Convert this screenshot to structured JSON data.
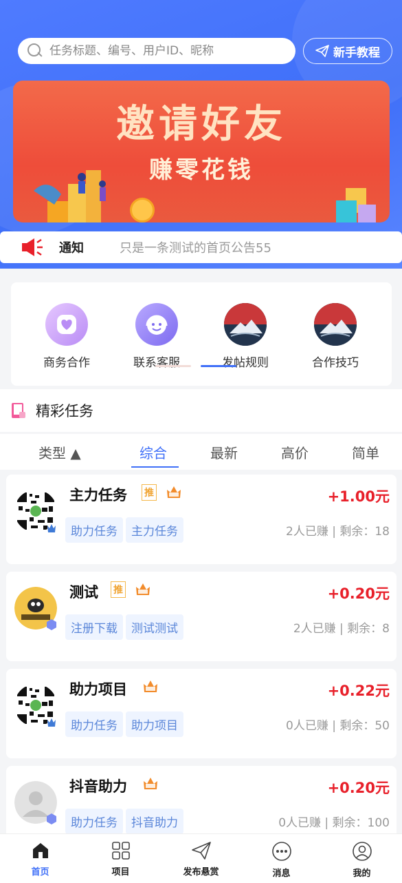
{
  "search": {
    "placeholder": "任务标题、编号、用户ID、昵称"
  },
  "tutorial_label": "新手教程",
  "banner": {
    "title": "邀请好友",
    "subtitle": "赚零花钱"
  },
  "notice": {
    "label": "通知",
    "text": "只是一条测试的首页公告55"
  },
  "quick_entries": [
    {
      "label": "商务合作",
      "icon": "heart-icon"
    },
    {
      "label": "联系客服",
      "icon": "headset-icon"
    },
    {
      "label": "发帖规则",
      "icon": "mountain-logo-icon"
    },
    {
      "label": "合作技巧",
      "icon": "mountain-logo-icon"
    }
  ],
  "section_title": "精彩任务",
  "filter_tabs": [
    "类型 ▲",
    "综合",
    "最新",
    "高价",
    "简单"
  ],
  "tasks": [
    {
      "title": "主力任务",
      "price": "+1.00元",
      "tags": [
        "助力任务",
        "主力任务"
      ],
      "stats": "2人已赚 | 剩余：18",
      "recommended": true,
      "recommend_label": "推"
    },
    {
      "title": "测试",
      "price": "+0.20元",
      "tags": [
        "注册下载",
        "测试测试"
      ],
      "stats": "2人已赚 | 剩余：8",
      "recommended": true,
      "recommend_label": "推"
    },
    {
      "title": "助力项目",
      "price": "+0.22元",
      "tags": [
        "助力任务",
        "助力项目"
      ],
      "stats": "0人已赚 | 剩余：50",
      "recommended": false
    },
    {
      "title": "抖音助力",
      "price": "+0.20元",
      "tags": [
        "助力任务",
        "抖音助力"
      ],
      "stats": "0人已赚 | 剩余：100",
      "recommended": false
    }
  ],
  "nav": [
    {
      "label": "首页",
      "icon": "home-icon"
    },
    {
      "label": "项目",
      "icon": "grid-icon"
    },
    {
      "label": "发布悬赏",
      "icon": "send-icon"
    },
    {
      "label": "消息",
      "icon": "message-icon"
    },
    {
      "label": "我的",
      "icon": "user-icon"
    }
  ],
  "colors": {
    "primary": "#3f6ff8",
    "price": "#e8202a",
    "banner": "#ee4d3a"
  }
}
